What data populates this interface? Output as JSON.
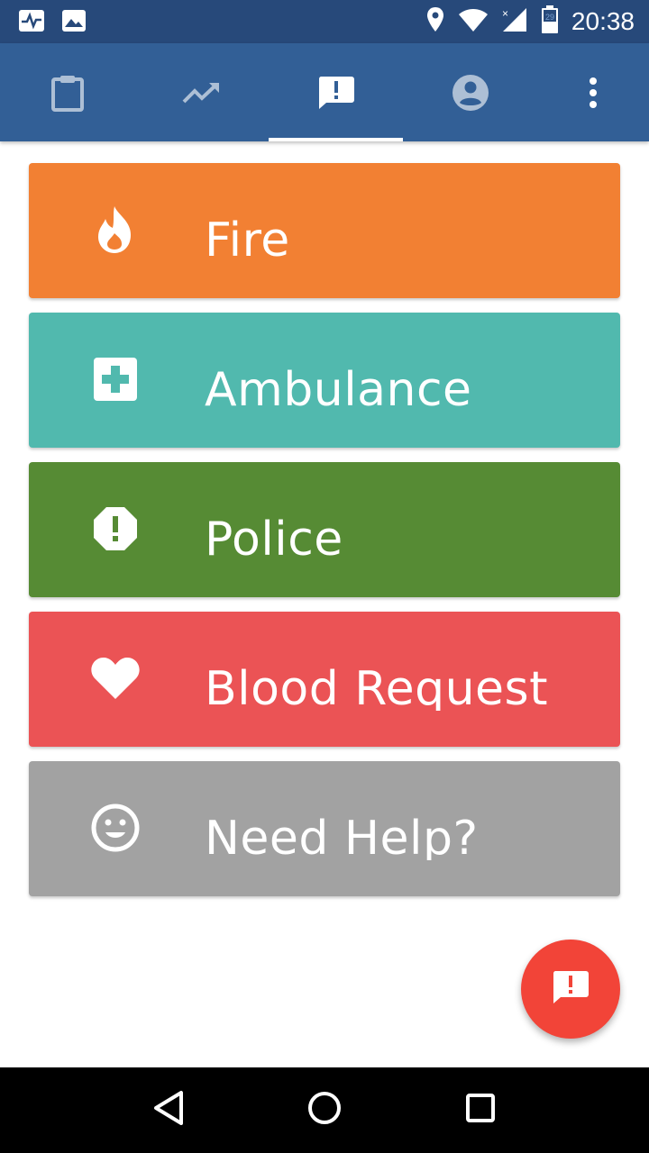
{
  "status_bar": {
    "time": "20:38",
    "battery_level": "29",
    "icons": [
      "pulse-icon",
      "image-icon",
      "location-icon",
      "wifi-icon",
      "signal-icon",
      "battery-icon"
    ]
  },
  "tabs": [
    {
      "icon": "clipboard-icon",
      "active": false
    },
    {
      "icon": "trending-up-icon",
      "active": false
    },
    {
      "icon": "alert-message-icon",
      "active": true
    },
    {
      "icon": "account-circle-icon",
      "active": false
    },
    {
      "icon": "more-vert-icon",
      "active": false
    }
  ],
  "cards": [
    {
      "label": "Fire",
      "icon": "fire-icon",
      "color": "#f28033"
    },
    {
      "label": "Ambulance",
      "icon": "medical-cross-icon",
      "color": "#51b9ae"
    },
    {
      "label": "Police",
      "icon": "warning-octagon-icon",
      "color": "#568b34"
    },
    {
      "label": "Blood Request",
      "icon": "heart-icon",
      "color": "#eb5355"
    },
    {
      "label": "Need Help?",
      "icon": "smiley-icon",
      "color": "#a2a2a2"
    }
  ],
  "fab": {
    "icon": "alert-message-icon",
    "color": "#f24438"
  },
  "colors": {
    "status_bar": "#27497a",
    "app_bar": "#325f96"
  }
}
